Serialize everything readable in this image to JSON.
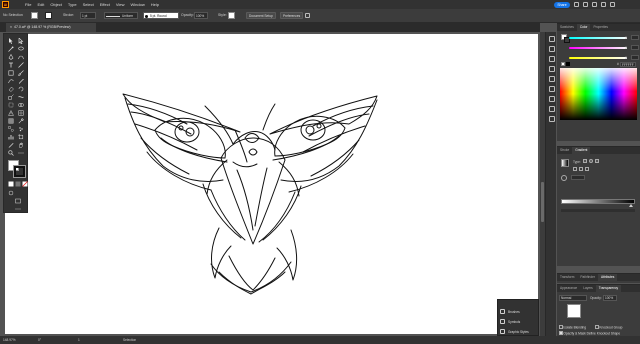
{
  "menubar": {
    "logo": "Ai",
    "items": [
      "File",
      "Edit",
      "Object",
      "Type",
      "Select",
      "Effect",
      "View",
      "Window",
      "Help"
    ],
    "share": "Share"
  },
  "control_bar": {
    "selection_label": "No Selection",
    "stroke_label": "Stroke:",
    "stroke_value": "1 pt",
    "profile_value": "Uniform",
    "brush_value": "5 pt. Round",
    "opacity_label": "Opacity:",
    "opacity_value": "100%",
    "style_label": "Style:",
    "doc_setup": "Document Setup",
    "preferences": "Preferences"
  },
  "document_tab": {
    "title": "47.0.ai* @ 148.97 % (RGB/Preview)",
    "close": "×"
  },
  "right_panels": {
    "color_tabs": [
      "Swatches",
      "Color",
      "Properties"
    ],
    "color_active": "Color",
    "hex_prefix": "#",
    "hex_value": "FFFFFF",
    "gradient_tabs": [
      "Stroke",
      "Gradient"
    ],
    "gradient_active": "Gradient",
    "gradient_type_label": "Type:",
    "bottom_tabs_1": [
      "Appearance",
      "Layers",
      "Transparency"
    ],
    "bottom_tabs_0": [
      "Transform",
      "Pathfinder",
      "Attributes"
    ],
    "blend_mode": "Normal",
    "opacity_label": "Opacity:",
    "opacity_value": "100%",
    "isolate_blending": "Isolate Blending",
    "knockout_group": "Knockout Group",
    "opacity_mask": "Opacity & Mask Define Knockout Shape"
  },
  "float_panel": {
    "items": [
      "Brushes",
      "Symbols",
      "Graphic Styles"
    ]
  },
  "status_bar": {
    "zoom": "148.97%",
    "angle": "0°",
    "artboard": "1",
    "tool": "Selection"
  },
  "colors": {
    "accent": "#1473e6",
    "app_bg": "#535353",
    "panel": "#3c3c3c",
    "dark": "#323232",
    "ai_orange": "#ff9a00"
  }
}
